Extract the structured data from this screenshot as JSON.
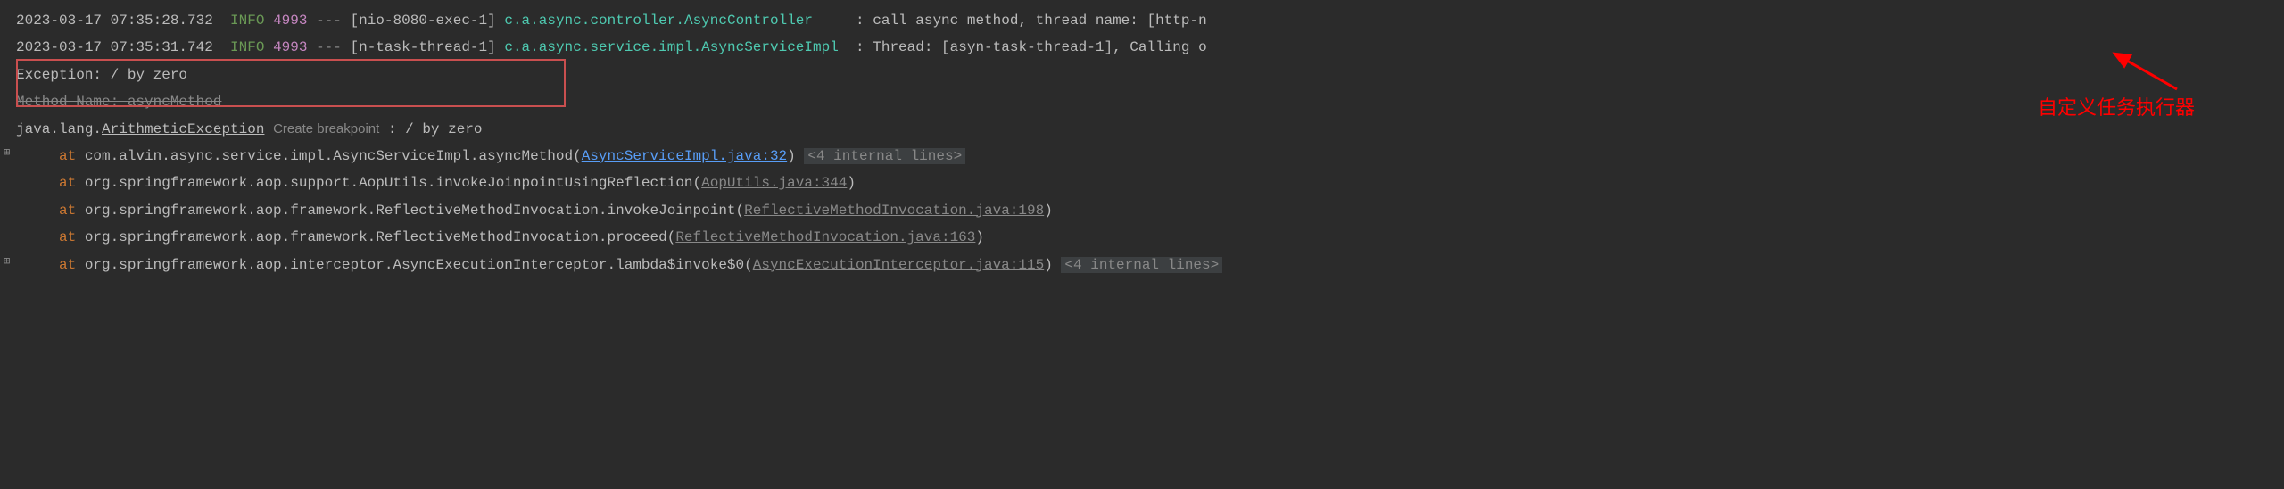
{
  "logs": [
    {
      "ts": "2023-03-17 07:35:28.732",
      "level": "INFO",
      "pid": "4993",
      "dashes": "---",
      "thread": "[nio-8080-exec-1]",
      "logger": "c.a.async.controller.AsyncController",
      "sep": ":",
      "msg": "call async method, thread name: [http-n"
    },
    {
      "ts": "2023-03-17 07:35:31.742",
      "level": "INFO",
      "pid": "4993",
      "dashes": "---",
      "thread": "[n-task-thread-1]",
      "logger": "c.a.async.service.impl.AsyncServiceImpl",
      "sep": ":",
      "msg": "Thread: [asyn-task-thread-1], Calling o"
    }
  ],
  "exception": {
    "line1": "Exception: / by zero",
    "line2": "Method Name: asyncMethod",
    "class_prefix": "java.lang.",
    "class_name": "ArithmeticException",
    "breakpoint_label": "Create breakpoint",
    "suffix": " : / by zero"
  },
  "stack": [
    {
      "at": "at",
      "text": "com.alvin.async.service.impl.AsyncServiceImpl.asyncMethod(",
      "link": "AsyncServiceImpl.java:32",
      "close": ")",
      "internal": "<4 internal lines>",
      "link_style": "blue",
      "has_expand": true
    },
    {
      "at": "at",
      "text": "org.springframework.aop.support.AopUtils.invokeJoinpointUsingReflection(",
      "link": "AopUtils.java:344",
      "close": ")",
      "link_style": "gray"
    },
    {
      "at": "at",
      "text": "org.springframework.aop.framework.ReflectiveMethodInvocation.invokeJoinpoint(",
      "link": "ReflectiveMethodInvocation.java:198",
      "close": ")",
      "link_style": "gray"
    },
    {
      "at": "at",
      "text": "org.springframework.aop.framework.ReflectiveMethodInvocation.proceed(",
      "link": "ReflectiveMethodInvocation.java:163",
      "close": ")",
      "link_style": "gray"
    },
    {
      "at": "at",
      "text": "org.springframework.aop.interceptor.AsyncExecutionInterceptor.lambda$invoke$0(",
      "link": "AsyncExecutionInterceptor.java:115",
      "close": ")",
      "internal": "<4 internal lines>",
      "link_style": "gray",
      "has_expand": true
    }
  ],
  "annotation": {
    "text": "自定义任务执行器"
  }
}
